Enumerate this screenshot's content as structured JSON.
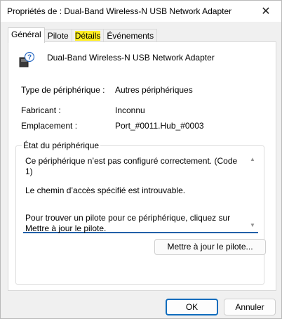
{
  "window": {
    "title": "Propriétés de : Dual-Band Wireless-N USB Network Adapter",
    "close_icon": "close-icon"
  },
  "tabs": [
    {
      "label": "Général",
      "active": true
    },
    {
      "label": "Pilote",
      "active": false
    },
    {
      "label": "Détails",
      "active": false,
      "highlighted": true
    },
    {
      "label": "Événements",
      "active": false
    }
  ],
  "device": {
    "icon": "unknown-device-icon",
    "name": "Dual-Band Wireless-N USB Network Adapter"
  },
  "properties": {
    "type_label": "Type de périphérique :",
    "type_value": "Autres périphériques",
    "manufacturer_label": "Fabricant :",
    "manufacturer_value": "Inconnu",
    "location_label": "Emplacement :",
    "location_value": "Port_#0011.Hub_#0003"
  },
  "status": {
    "group_label": "État du périphérique",
    "lines": [
      "Ce périphérique n’est pas configuré correctement. (Code 1)",
      "Le chemin d’accès spécifié est introuvable.",
      "Pour trouver un pilote pour ce périphérique, cliquez sur Mettre à jour le pilote."
    ]
  },
  "buttons": {
    "update_driver": "Mettre à jour le pilote...",
    "ok": "OK",
    "cancel": "Annuler"
  },
  "colors": {
    "highlight": "#ffee22",
    "accent": "#0f6cbd"
  }
}
